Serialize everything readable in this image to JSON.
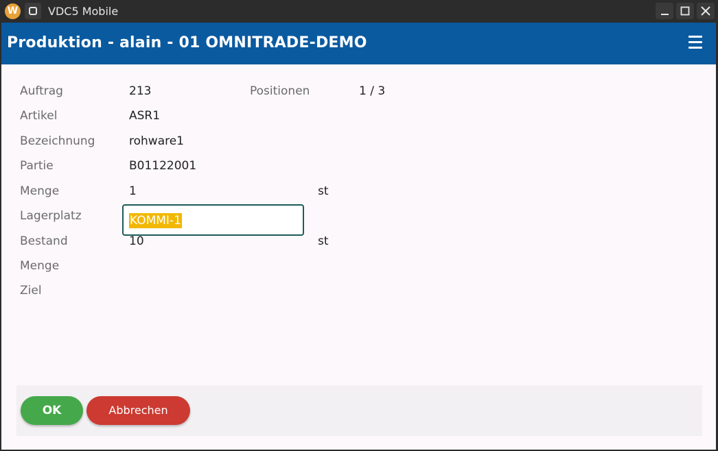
{
  "window": {
    "title": "VDC5 Mobile",
    "logo_letter": "W"
  },
  "appbar": {
    "title": "Produktion - alain - 01 OMNITRADE-DEMO"
  },
  "form": {
    "rows": [
      {
        "label": "Auftrag",
        "value": "213"
      },
      {
        "label": "Artikel",
        "value": "ASR1"
      },
      {
        "label": "Bezeichnung",
        "value": "rohware1"
      },
      {
        "label": "Partie",
        "value": "B01122001"
      },
      {
        "label": "Menge",
        "value": "1",
        "unit": "st"
      },
      {
        "label": "Lagerplatz",
        "input_value": "KOMMI-1"
      },
      {
        "label": "Bestand",
        "value": "10",
        "unit": "st"
      },
      {
        "label": "Menge"
      },
      {
        "label": "Ziel"
      }
    ],
    "positionen_label": "Positionen",
    "positionen_value": "1 / 3"
  },
  "buttons": {
    "ok": "OK",
    "cancel": "Abbrechen"
  },
  "colors": {
    "appbar": "#0a5aa0",
    "ok": "#45a84a",
    "cancel": "#cc3a32",
    "selection": "#f2b700",
    "focus_border": "#1c5a5a"
  }
}
